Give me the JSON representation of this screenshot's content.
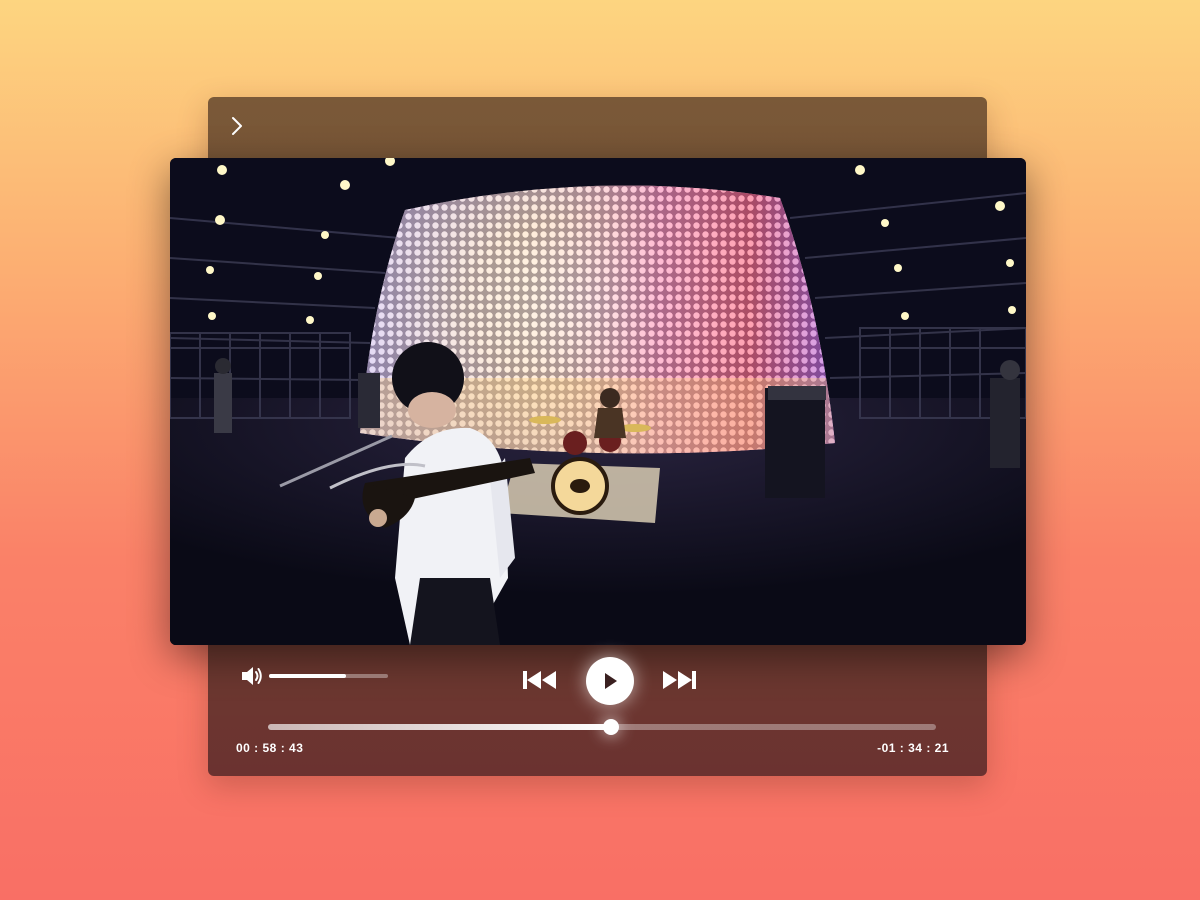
{
  "player": {
    "back_icon": "chevron-right-icon",
    "volume_icon": "speaker-icon",
    "volume_level": 0.65,
    "prev_icon": "skip-previous-icon",
    "play_icon": "play-icon",
    "next_icon": "skip-next-icon",
    "progress": 0.513,
    "time_elapsed": "00 : 58 : 43",
    "time_remaining": "-01 : 34 : 21"
  },
  "video": {
    "description_icon": "video-frame"
  },
  "colors": {
    "background_top": "#fdd580",
    "background_bottom": "#f96f65",
    "panel_top": "#7a5938",
    "panel_bottom": "#6b3230",
    "accent": "#ffffff"
  }
}
